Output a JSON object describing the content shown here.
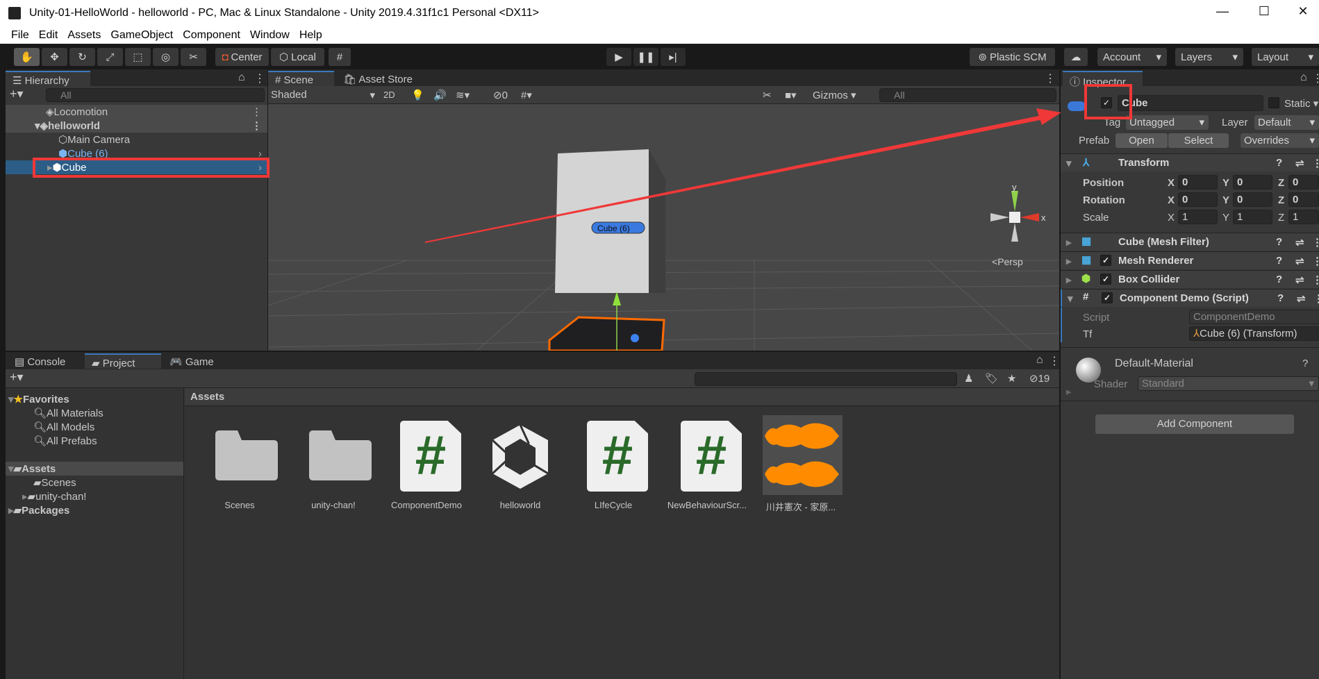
{
  "window": {
    "title": "Unity-01-HelloWorld - helloworld - PC, Mac & Linux Standalone - Unity 2019.4.31f1c1 Personal <DX11>",
    "minimize": "—",
    "maximize": "☐",
    "close": "✕"
  },
  "menu": [
    "File",
    "Edit",
    "Assets",
    "GameObject",
    "Component",
    "Window",
    "Help"
  ],
  "toolbar": {
    "center": "Center",
    "local": "Local",
    "plastic": "Plastic SCM",
    "account": "Account",
    "layers": "Layers",
    "layout": "Layout"
  },
  "hierarchy": {
    "tab": "Hierarchy",
    "search_placeholder": "All",
    "items": [
      {
        "label": "Locomotion",
        "type": "scene"
      },
      {
        "label": "helloworld",
        "type": "scene"
      },
      {
        "label": "Main Camera"
      },
      {
        "label": "Cube (6)",
        "prefab": true
      },
      {
        "label": "Cube",
        "selected": true
      }
    ]
  },
  "scene": {
    "tabs": [
      "Scene",
      "Asset Store"
    ],
    "shading": "Shaded",
    "mode2d": "2D",
    "hidden_count": "0",
    "gizmos": "Gizmos",
    "search_placeholder": "All",
    "persp": "Persp",
    "label_cube6": "Cube (6)",
    "axis_y": "y",
    "axis_x": "x"
  },
  "inspector": {
    "tab": "Inspector",
    "name": "Cube",
    "active": true,
    "static_label": "Static",
    "tag_label": "Tag",
    "tag": "Untagged",
    "layer_label": "Layer",
    "layer": "Default",
    "prefab_label": "Prefab",
    "open": "Open",
    "select": "Select",
    "overrides": "Overrides",
    "transform": {
      "title": "Transform",
      "position": {
        "label": "Position",
        "x": "0",
        "y": "0",
        "z": "0"
      },
      "rotation": {
        "label": "Rotation",
        "x": "0",
        "y": "0",
        "z": "0"
      },
      "scale": {
        "label": "Scale",
        "x": "1",
        "y": "1",
        "z": "1"
      },
      "ax": "X",
      "ay": "Y",
      "az": "Z"
    },
    "components": [
      {
        "title": "Cube (Mesh Filter)"
      },
      {
        "title": "Mesh Renderer",
        "enabled": true
      },
      {
        "title": "Box Collider",
        "enabled": true
      },
      {
        "title": "Component Demo (Script)",
        "enabled": true
      }
    ],
    "script_label": "Script",
    "script_value": "ComponentDemo",
    "tf_label": "Tf",
    "tf_value": "Cube (6) (Transform)",
    "material": "Default-Material",
    "shader_label": "Shader",
    "shader": "Standard",
    "add_component": "Add Component"
  },
  "bottom": {
    "tabs": [
      "Console",
      "Project",
      "Game"
    ],
    "hidden_count": "19"
  },
  "project": {
    "favorites": "Favorites",
    "fav_items": [
      "All Materials",
      "All Models",
      "All Prefabs"
    ],
    "assets": "Assets",
    "asset_children": [
      "Scenes",
      "unity-chan!"
    ],
    "packages": "Packages",
    "breadcrumb": "Assets",
    "items": [
      {
        "name": "Scenes",
        "type": "folder"
      },
      {
        "name": "unity-chan!",
        "type": "folder"
      },
      {
        "name": "ComponentDemo",
        "type": "script"
      },
      {
        "name": "helloworld",
        "type": "scene"
      },
      {
        "name": "LIfeCycle",
        "type": "script"
      },
      {
        "name": "NewBehaviourScr...",
        "type": "script"
      },
      {
        "name": "川井憲次 - 家原...",
        "type": "audio"
      }
    ]
  },
  "colors": {
    "accent": "#3a79bb",
    "selection": "#2c5d87",
    "annotation": "#f03838",
    "audio": "#ff8c00",
    "script_hash": "#2a6a2a"
  }
}
